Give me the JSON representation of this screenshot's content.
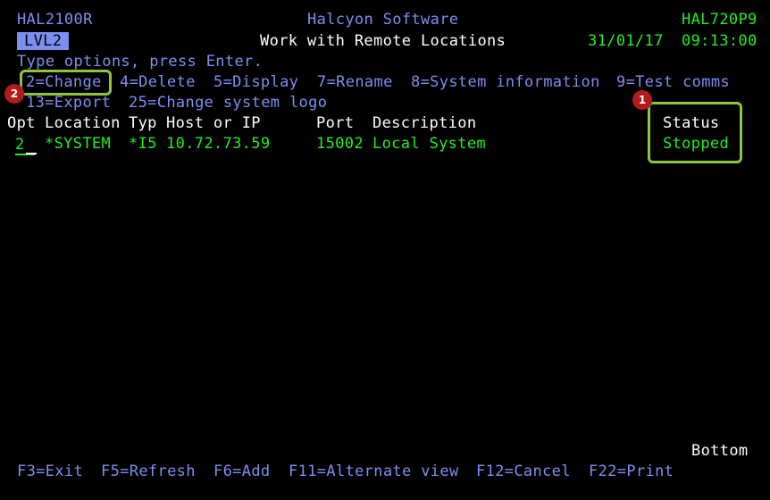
{
  "header": {
    "program": "HAL2100R",
    "company": "Halcyon Software",
    "system": "HAL720P9",
    "level": "LVL2",
    "title": "Work with Remote Locations",
    "date": "31/01/17",
    "time": "09:13:00"
  },
  "instructions": "Type options, press Enter.",
  "options": [
    "2=Change",
    "4=Delete",
    "5=Display",
    "7=Rename",
    "8=System information",
    "9=Test comms",
    "13=Export",
    "25=Change system logo"
  ],
  "table": {
    "columns": [
      "Opt",
      "Location",
      "Typ",
      "Host or IP",
      "Port",
      "Description",
      "Status"
    ],
    "rows": [
      {
        "opt": "2",
        "location": "*SYSTEM",
        "typ": "*I5",
        "host": "10.72.73.59",
        "port": "15002",
        "description": "Local System",
        "status": "Stopped"
      }
    ]
  },
  "scroll_indicator": "Bottom",
  "function_keys": [
    "F3=Exit",
    "F5=Refresh",
    "F6=Add",
    "F11=Alternate view",
    "F12=Cancel",
    "F22=Print"
  ],
  "annotations": {
    "badge_1": "1",
    "badge_2": "2"
  },
  "colors": {
    "background": "#000000",
    "text_blue": "#7b8ff0",
    "text_green": "#22ee22",
    "text_white": "#ffffff",
    "highlight_border": "#8cc63f",
    "badge": "#b31a1a"
  }
}
